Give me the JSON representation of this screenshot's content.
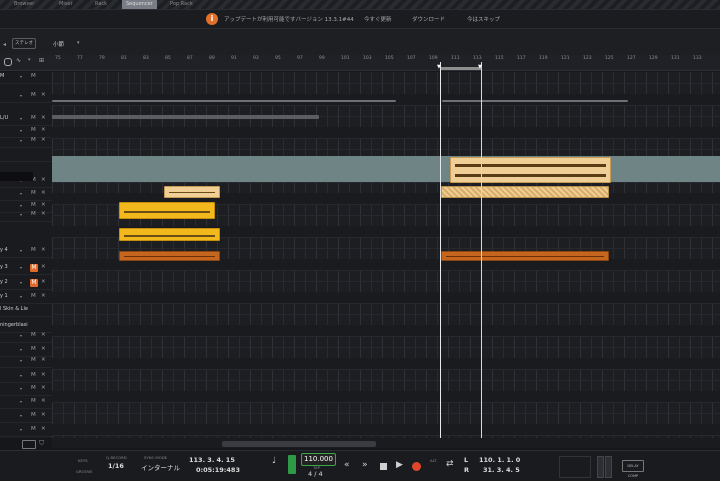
{
  "top_tabs": [
    {
      "label": "Browser"
    },
    {
      "label": "Mixer"
    },
    {
      "label": "Rack"
    },
    {
      "label": "Sequencer",
      "active": true
    },
    {
      "label": "Pop Rack"
    }
  ],
  "notification": {
    "icon": "info-icon",
    "icon_glyph": "i",
    "message": "アップデートが利用可能ですバージョン 13.3.1#44",
    "buttons": [
      "今すぐ更新",
      "ダウンロード",
      "今はスキップ"
    ]
  },
  "toolbar": {
    "track_select": "ステレオ",
    "bar_select": "小節",
    "bar_chev": "▾"
  },
  "ruler": {
    "labels": [
      "75",
      "77",
      "79",
      "81",
      "83",
      "85",
      "87",
      "89",
      "91",
      "93",
      "95",
      "97",
      "99",
      "101",
      "103",
      "105",
      "107",
      "109",
      "111",
      "113",
      "115",
      "117",
      "119",
      "121",
      "123",
      "125",
      "127",
      "129",
      "131",
      "133"
    ]
  },
  "headers": [
    {
      "label": "M",
      "m": "M",
      "x": "",
      "muted": false
    },
    {
      "label": "",
      "m": "M",
      "x": "✕",
      "muted": false
    },
    {
      "label": "L/U",
      "m": "M",
      "x": "✕",
      "muted": false
    },
    {
      "label": "",
      "m": "M",
      "x": "✕",
      "muted": false
    },
    {
      "label": "",
      "m": "M",
      "x": "✕",
      "muted": false
    },
    {
      "label": "",
      "m": "",
      "x": "",
      "muted": false
    },
    {
      "label": "",
      "m": "M",
      "x": "✕",
      "muted": false
    },
    {
      "label": "",
      "m": "M",
      "x": "✕",
      "muted": false
    },
    {
      "label": "",
      "m": "M",
      "x": "✕",
      "muted": false
    },
    {
      "label": "",
      "m": "M",
      "x": "✕",
      "muted": false
    },
    {
      "label": "y 4",
      "m": "M",
      "x": "✕",
      "muted": false
    },
    {
      "label": "y 3",
      "m": "M",
      "x": "✕",
      "muted": true
    },
    {
      "label": "y 2",
      "m": "M",
      "x": "✕",
      "muted": true
    },
    {
      "label": "y 1",
      "m": "M",
      "x": "✕",
      "muted": false
    },
    {
      "label": "l Skin & Lle",
      "m": "",
      "x": "",
      "muted": false
    },
    {
      "label": "ningerblasi",
      "m": "",
      "x": "",
      "muted": false
    },
    {
      "label": "",
      "m": "M",
      "x": "✕",
      "muted": false
    },
    {
      "label": "",
      "m": "M",
      "x": "✕",
      "muted": false
    },
    {
      "label": "",
      "m": "M",
      "x": "✕",
      "muted": false
    },
    {
      "label": "",
      "m": "M",
      "x": "✕",
      "muted": false
    },
    {
      "label": "",
      "m": "M",
      "x": "✕",
      "muted": false
    },
    {
      "label": "",
      "m": "M",
      "x": "✕",
      "muted": false
    },
    {
      "label": "",
      "m": "M",
      "x": "✕",
      "muted": false
    },
    {
      "label": "",
      "m": "M",
      "x": "✕",
      "muted": false
    }
  ],
  "transport": {
    "key_label": "KEYS",
    "groove_label": "GROOVE",
    "quantize_label": "Q-RECORD",
    "quantize_value": "1/16",
    "sync_label": "SYNC MODE",
    "sync_value": "インターナル",
    "song_pos": "113. 3. 4. 15",
    "time_pos": "0:05:19:483",
    "tempo": "110.000",
    "tempo_label": "TAP",
    "signature": "4 / 4",
    "loop_l_label": "L",
    "loop_l": "110. 1. 1. 0",
    "loop_r_label": "R",
    "loop_r": "31. 3. 4. 5",
    "alt_label": "ALT",
    "delay_label": "DELAY COMP"
  },
  "colors": {
    "clip_gold": "#f2b81c",
    "clip_beige": "#f0cf96",
    "clip_brown": "#c5661f",
    "teal": "#6f8585",
    "rec": "#e0462c",
    "mute_active": "#e06a2c"
  }
}
